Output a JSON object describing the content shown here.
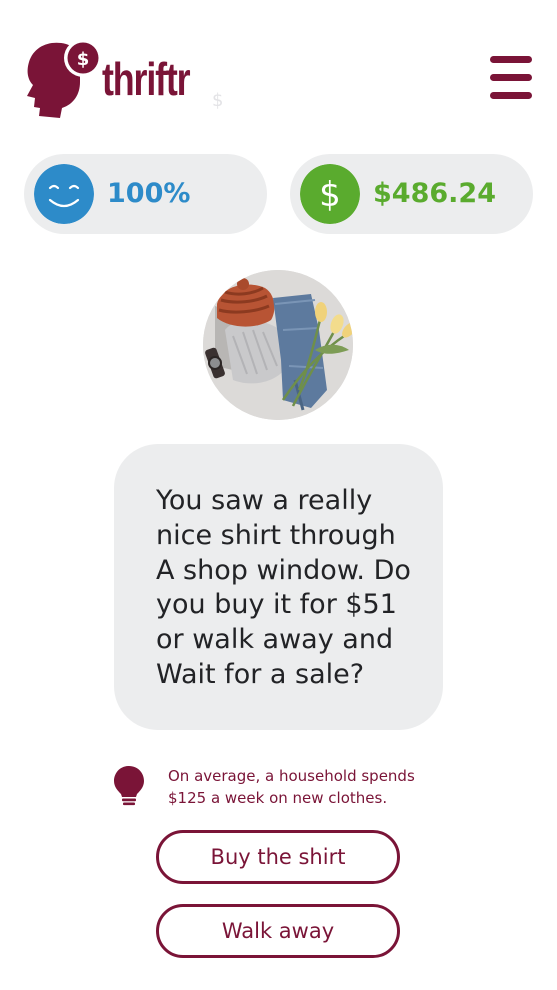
{
  "app": {
    "brand_name": "thriftr",
    "logo_icon": "head-with-coin-icon",
    "background_glyph": "$"
  },
  "header": {
    "menu_icon": "hamburger-menu-icon"
  },
  "stats": {
    "happiness": {
      "icon": "smiley-face-icon",
      "value": "100%",
      "color": "#2d8bc9"
    },
    "money": {
      "icon": "dollar-sign-icon",
      "value": "$486.24",
      "color": "#5aab2e"
    }
  },
  "scenario": {
    "image": "folded-clothes-with-tulips-photo",
    "question_lines": [
      "You saw a really",
      "nice shirt through",
      "A shop window. Do",
      "you buy it for $51",
      "or walk away and",
      "Wait for a sale?"
    ]
  },
  "tip": {
    "icon": "lightbulb-icon",
    "lines": [
      "On average, a household spends",
      "$125 a week on new clothes."
    ]
  },
  "choices": [
    {
      "label": "Buy the shirt"
    },
    {
      "label": "Walk away"
    }
  ],
  "colors": {
    "brand": "#7a1437",
    "pill_background": "#ecedee",
    "text": "#222326"
  }
}
